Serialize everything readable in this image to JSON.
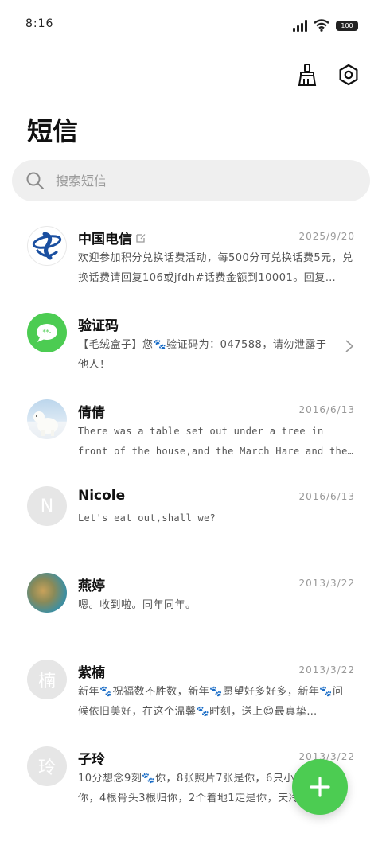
{
  "status": {
    "time": "8:16",
    "battery": "100"
  },
  "title": "短信",
  "search": {
    "placeholder": "搜索短信"
  },
  "colors": {
    "accent": "#4ccc52",
    "telecom_blue": "#1a4fa0"
  },
  "threads": [
    {
      "name": "中国电信",
      "date": "2025/9/20",
      "preview": "欢迎参加积分兑换话费活动，每500分可兑换话费5元，兑换话费请回复106或jfdh#话费金额到10001。回复…"
    },
    {
      "name": "验证码",
      "date": "",
      "preview": "【毛绒盒子】您🐾验证码为：047588，请勿泄露于他人！"
    },
    {
      "name": "倩倩",
      "date": "2016/6/13",
      "preview": "There was a table set out under a tree in front of the house,and the March Hare and the Hatter we…"
    },
    {
      "name": "Nicole",
      "avatar_letter": "N",
      "date": "2016/6/13",
      "preview": "Let's eat out,shall we?"
    },
    {
      "name": "燕婷",
      "date": "2013/3/22",
      "preview": "嗯。收到啦。同年同年。"
    },
    {
      "name": "紫楠",
      "avatar_letter": "楠",
      "date": "2013/3/22",
      "preview": "新年🐾祝福数不胜数，新年🐾愿望好多好多，新年🐾问候依旧美好，在这个温馨🐾时刻，送上😊最真挚…"
    },
    {
      "name": "子玲",
      "avatar_letter": "玲",
      "date": "2013/3/22",
      "preview": "10分想念9刻🐾你，8张照片7张是你，6只小狗5只像你，4根骨头3根归你，2个着地1定是你，天冷了…"
    }
  ]
}
